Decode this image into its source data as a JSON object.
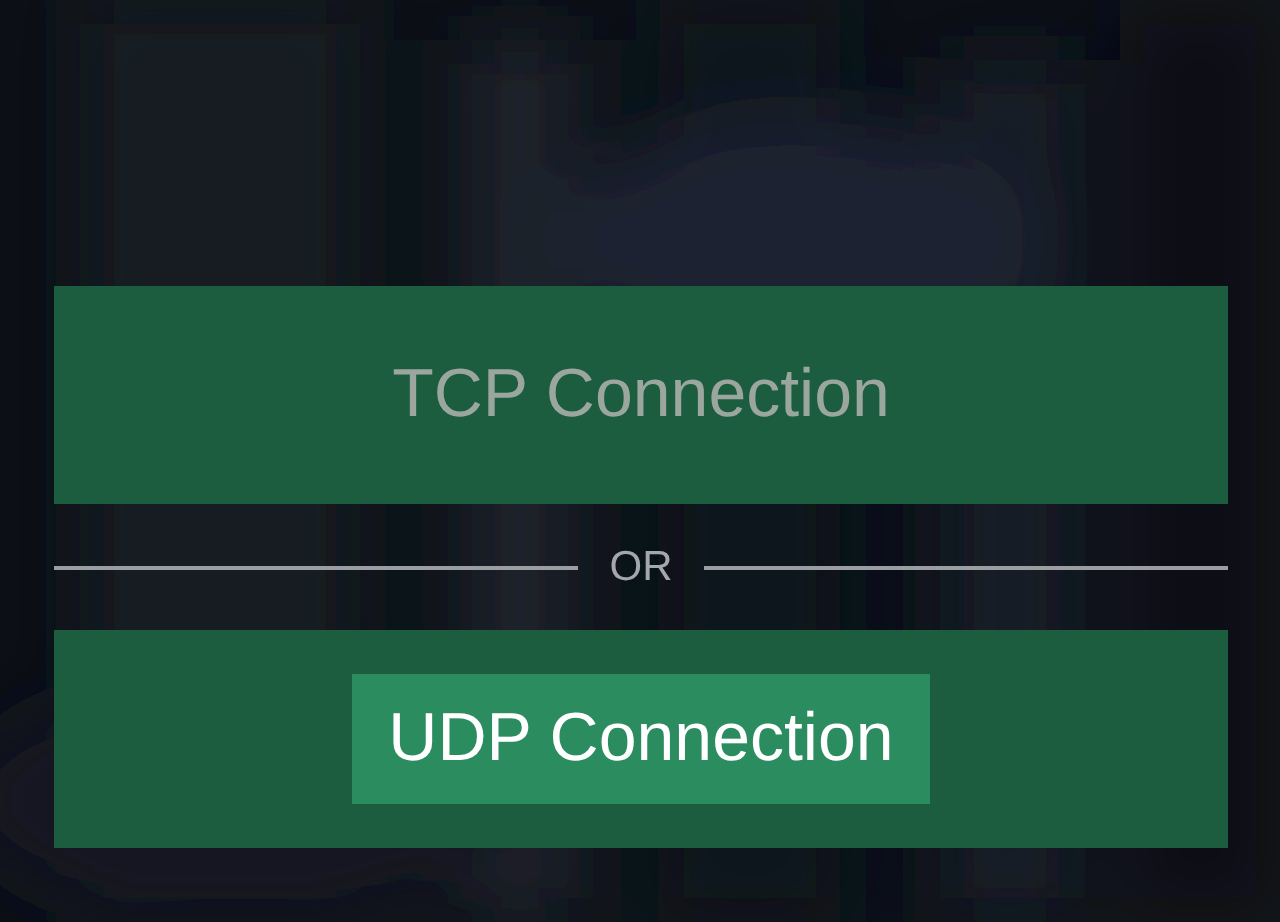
{
  "options": [
    {
      "label": "TCP Connection",
      "selected": false
    },
    {
      "label": "UDP Connection",
      "selected": true
    }
  ],
  "separator": {
    "label": "OR"
  }
}
